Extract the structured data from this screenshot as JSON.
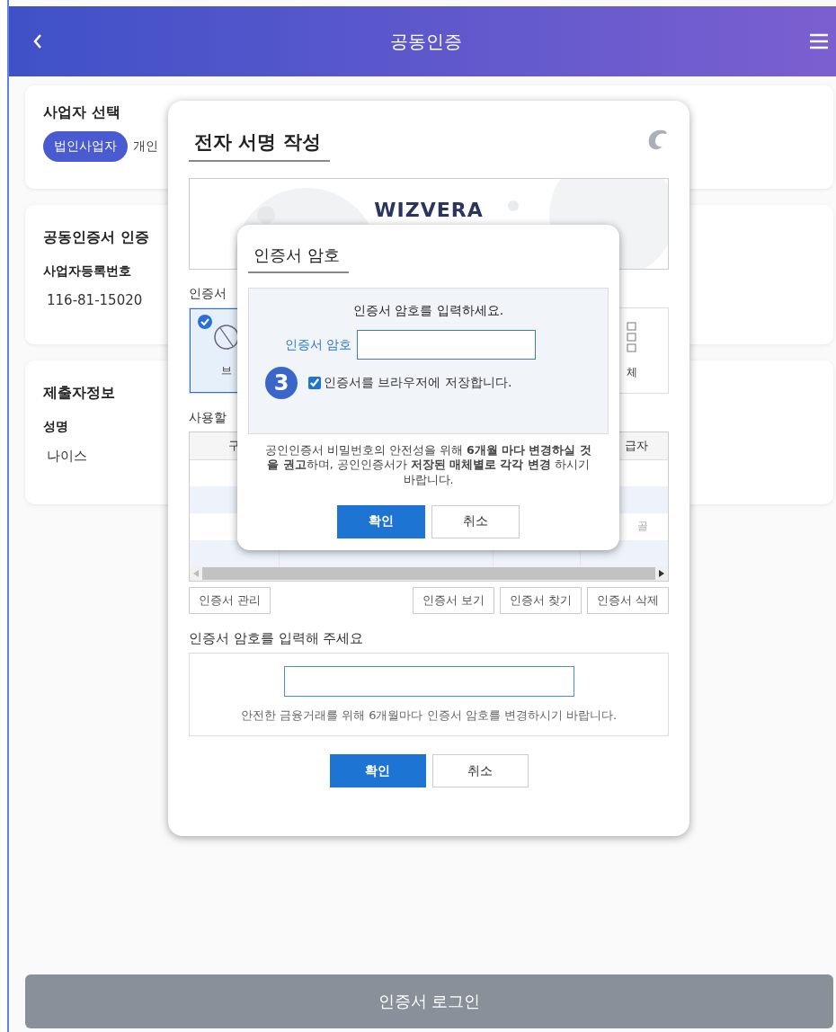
{
  "header": {
    "title": "공동인증"
  },
  "business_select": {
    "title": "사업자 선택",
    "options": [
      {
        "label": "법인사업자",
        "selected": true
      },
      {
        "label": "개인",
        "selected": false
      }
    ]
  },
  "cert_section": {
    "title": "공동인증서 인증",
    "field_label": "사업자등록번호",
    "value": "116-81-15020"
  },
  "submitter": {
    "title": "제출자정보",
    "field_label": "성명",
    "value": "나이스"
  },
  "login_button": {
    "label": "인증서 로그인"
  },
  "sign_dialog": {
    "title": "전자 서명 작성",
    "logo": "WIZVERA",
    "storage_label": "인증서",
    "storage_options": [
      {
        "label": "브",
        "selected": true,
        "kind": "browser"
      },
      {
        "label": "체",
        "selected": false,
        "kind": "media"
      }
    ],
    "table_label": "사용할",
    "table": {
      "columns": [
        "구",
        "급자"
      ],
      "rows": [
        {
          "cell": null
        },
        {
          "cell": null
        },
        {
          "cell": "골"
        },
        {
          "cell": null
        }
      ]
    },
    "cert_buttons": [
      "인증서 관리",
      "인증서 보기",
      "인증서 찾기",
      "인증서 삭제"
    ],
    "password_label": "인증서 암호를 입력해 주세요",
    "password_note": "안전한 금융거래를 위해 6개월마다 인증서 암호를 변경하시기 바랍니다.",
    "buttons": [
      {
        "label": "확인",
        "kind": "primary"
      },
      {
        "label": "취소",
        "kind": "secondary"
      }
    ]
  },
  "password_dialog": {
    "title": "인증서 암호",
    "prompt": "인증서 암호를 입력하세요.",
    "field_label": "인증서 암호",
    "step": "3",
    "save_option": {
      "label": "인증서를 브라우저에 저장합니다.",
      "checked": true
    },
    "note": "공인인증서 비밀번호의 안전성을 위해 **6개월 마다 변경하실 것을 권고**하며, 공인인증서가 **저장된 매체별로 각각 변경** 하시기 바랍니다.",
    "buttons": [
      {
        "label": "확인",
        "kind": "primary"
      },
      {
        "label": "취소",
        "kind": "secondary"
      }
    ]
  }
}
